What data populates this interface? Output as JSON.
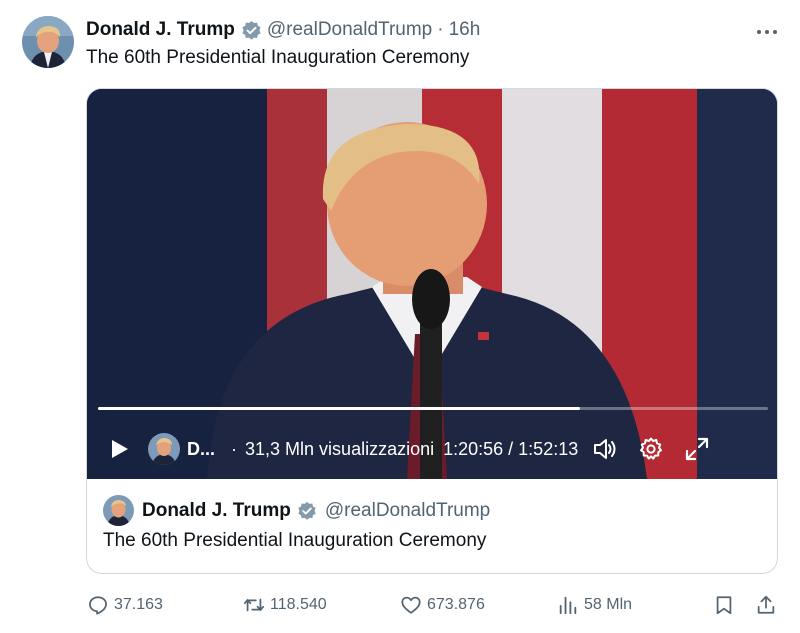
{
  "post": {
    "author_name": "Donald J. Trump",
    "handle": "@realDonaldTrump",
    "separator": "·",
    "time": "16h",
    "text": "The 60th Presidential Inauguration Ceremony",
    "more_icon": "more-horizontal-icon",
    "verified_color": "#829aab"
  },
  "video": {
    "author_short": "D...",
    "views_separator": "·",
    "views_label": "31,3 Mln visualizzazioni",
    "timecode": "1:20:56 / 1:52:13",
    "progress_fraction": 0.72,
    "icons": [
      "play-icon",
      "volume-icon",
      "settings-gear-icon",
      "fullscreen-icon"
    ]
  },
  "quoted": {
    "author_name": "Donald J. Trump",
    "handle": "@realDonaldTrump",
    "text": "The 60th Presidential Inauguration Ceremony"
  },
  "actions": {
    "replies": "37.163",
    "reposts": "118.540",
    "likes": "673.876",
    "views": "58 Mln",
    "icons": [
      "reply-icon",
      "repost-icon",
      "like-icon",
      "views-icon",
      "bookmark-icon",
      "share-icon"
    ]
  },
  "colors": {
    "text_primary": "#0f1419",
    "text_secondary": "#536471",
    "border": "#cfd9de"
  }
}
